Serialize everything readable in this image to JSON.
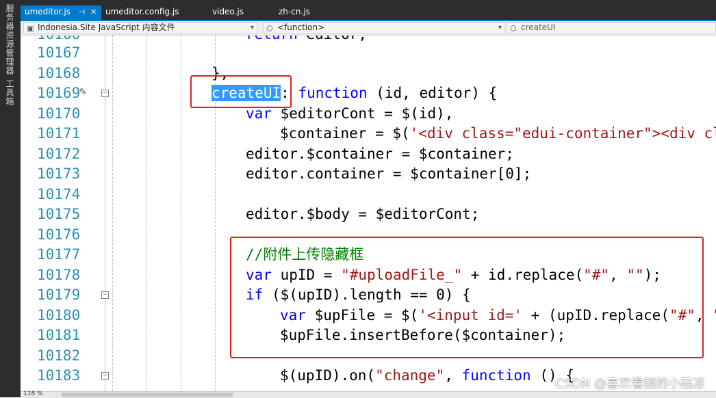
{
  "side_panel": {
    "server_explorer": "服务器资源管理器",
    "toolbox": "工具箱"
  },
  "tabs": [
    {
      "label": "umeditor.js",
      "active": true
    },
    {
      "label": "umeditor.config.js",
      "active": false
    },
    {
      "label": "video.js",
      "active": false
    },
    {
      "label": "zh-cn.js",
      "active": false
    }
  ],
  "nav": {
    "scope": "Indonesia.Site JavaScript 内容文件",
    "member": "<function>",
    "right": "createUI"
  },
  "code_lines": [
    {
      "num": "10166",
      "text": "return editor;"
    },
    {
      "num": "10167",
      "text": ""
    },
    {
      "num": "10168",
      "text": "},"
    },
    {
      "num": "10169",
      "text": "createUI: function (id, editor) {"
    },
    {
      "num": "10170",
      "text": "var $editorCont = $(id),"
    },
    {
      "num": "10171",
      "text": "$container = $('<div class=\"edui-container\"><div cla"
    },
    {
      "num": "10172",
      "text": "editor.$container = $container;"
    },
    {
      "num": "10173",
      "text": "editor.container = $container[0];"
    },
    {
      "num": "10174",
      "text": ""
    },
    {
      "num": "10175",
      "text": "editor.$body = $editorCont;"
    },
    {
      "num": "10176",
      "text": ""
    },
    {
      "num": "10177",
      "text": "//附件上传隐藏框"
    },
    {
      "num": "10178",
      "text": "var upID = \"#uploadFile_\" + id.replace(\"#\", \"\");"
    },
    {
      "num": "10179",
      "text": "if ($(upID).length == 0) {"
    },
    {
      "num": "10180",
      "text": "var $upFile = $('<input id=' + (upID.replace(\"#\", \"\""
    },
    {
      "num": "10181",
      "text": "$upFile.insertBefore($container);"
    },
    {
      "num": "10182",
      "text": ""
    },
    {
      "num": "10183",
      "text": "$(upID).on(\"change\", function () {"
    }
  ],
  "status": {
    "zoom": "118 %"
  },
  "watermark": "CSDN @喜欢看剧的小菇凉",
  "colors": {
    "keyword": "#0000ff",
    "string": "#a31515",
    "comment": "#008000",
    "line_number": "#2b91af",
    "selection": "#3399ff",
    "annotation_box": "#e02020",
    "tab_active": "#007acc"
  }
}
